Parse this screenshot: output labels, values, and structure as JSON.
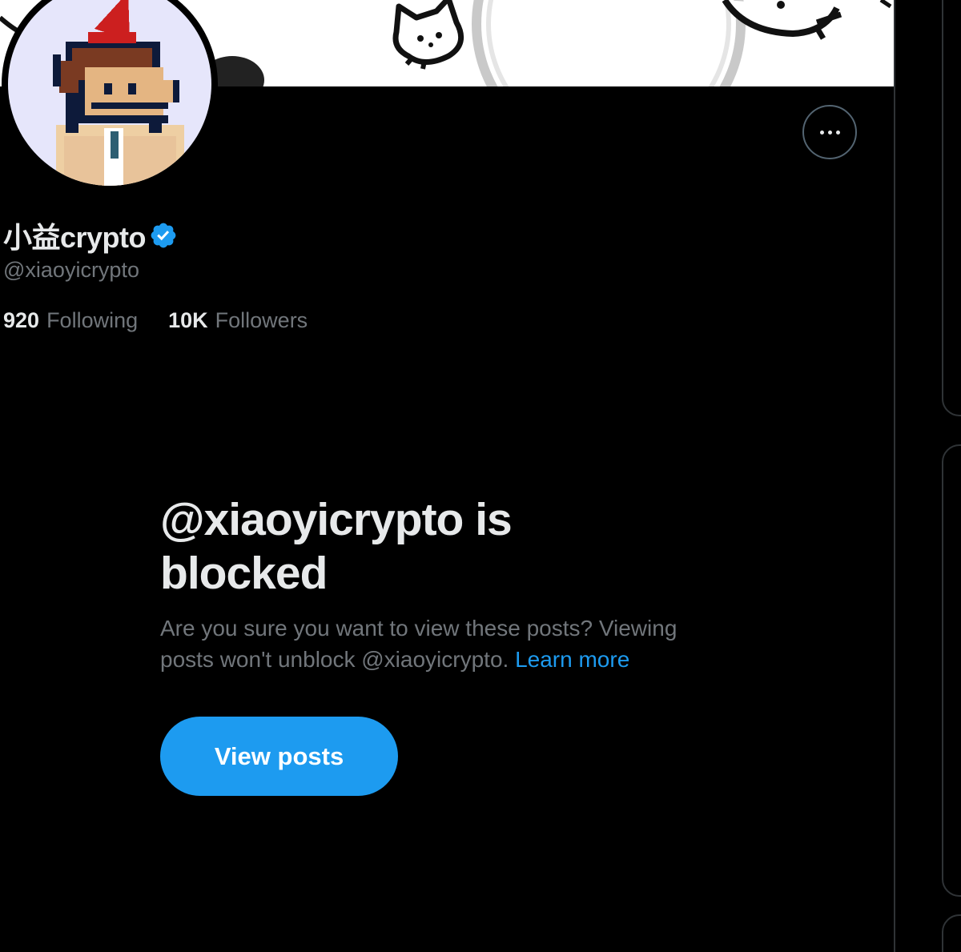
{
  "profile": {
    "display_name": "小益crypto",
    "handle": "@xiaoyicrypto",
    "verified": true,
    "following_count": "920",
    "following_label": "Following",
    "followers_count": "10K",
    "followers_label": "Followers"
  },
  "blocked_notice": {
    "title_line1": "@xiaoyicrypto is",
    "title_line2": "blocked",
    "description": "Are you sure you want to view these posts? Viewing posts won't unblock @xiaoyicrypto.",
    "learn_more_label": "Learn more",
    "view_posts_label": "View posts"
  },
  "icons": {
    "more": "more-options-icon",
    "verified": "verified-badge-icon"
  },
  "colors": {
    "background": "#000000",
    "text_primary": "#e7e9ea",
    "text_secondary": "#71767b",
    "accent": "#1d9bf0",
    "border": "#2f3336"
  }
}
